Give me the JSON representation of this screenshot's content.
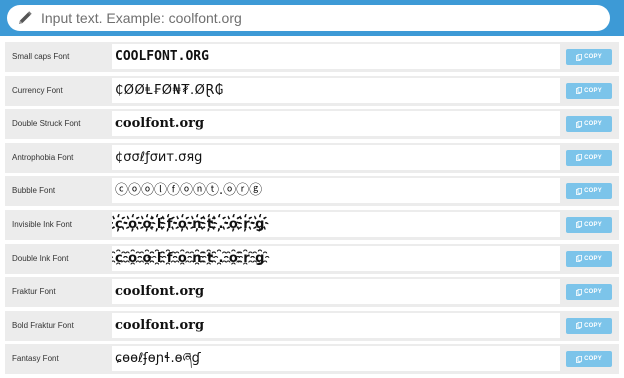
{
  "search": {
    "placeholder": "Input text. Example: coolfont.org",
    "icon": "pencil-icon"
  },
  "copy_label": "COPY",
  "colors": {
    "topbar": "#3d9ad6",
    "copy_button": "#7cc4ea",
    "row_bg": "#ececec"
  },
  "rows": [
    {
      "label": "Small caps Font",
      "output": "COOLFONT.ORG"
    },
    {
      "label": "Currency Font",
      "output": "₵ØØⱠ₣Ø₦₮.ØⱤ₲"
    },
    {
      "label": "Double Struck Font",
      "output": "coolfont.org"
    },
    {
      "label": "Antrophobia Font",
      "output": "¢σσℓƒσит.σяg"
    },
    {
      "label": "Bubble Font",
      "output": "ⓒⓞⓞⓛⓕⓞⓝⓣ.ⓞⓡⓖ"
    },
    {
      "label": "Invisible Ink Font",
      "output": "c҉o҉o҉l҉f҉o҉n҉t҉.҉o҉r҉g҉"
    },
    {
      "label": "Double Ink Font",
      "output": "c҈o҈o҈l҈f҈o҈n҈t҈.҈o҈r҈g҈"
    },
    {
      "label": "Fraktur Font",
      "output": "coolfont.org"
    },
    {
      "label": "Bold Fraktur Font",
      "output": "coolfont.org"
    },
    {
      "label": "Fantasy Font",
      "output": "ɕѳѳℓʄѳɲɬ.ѳཞɠ"
    }
  ]
}
